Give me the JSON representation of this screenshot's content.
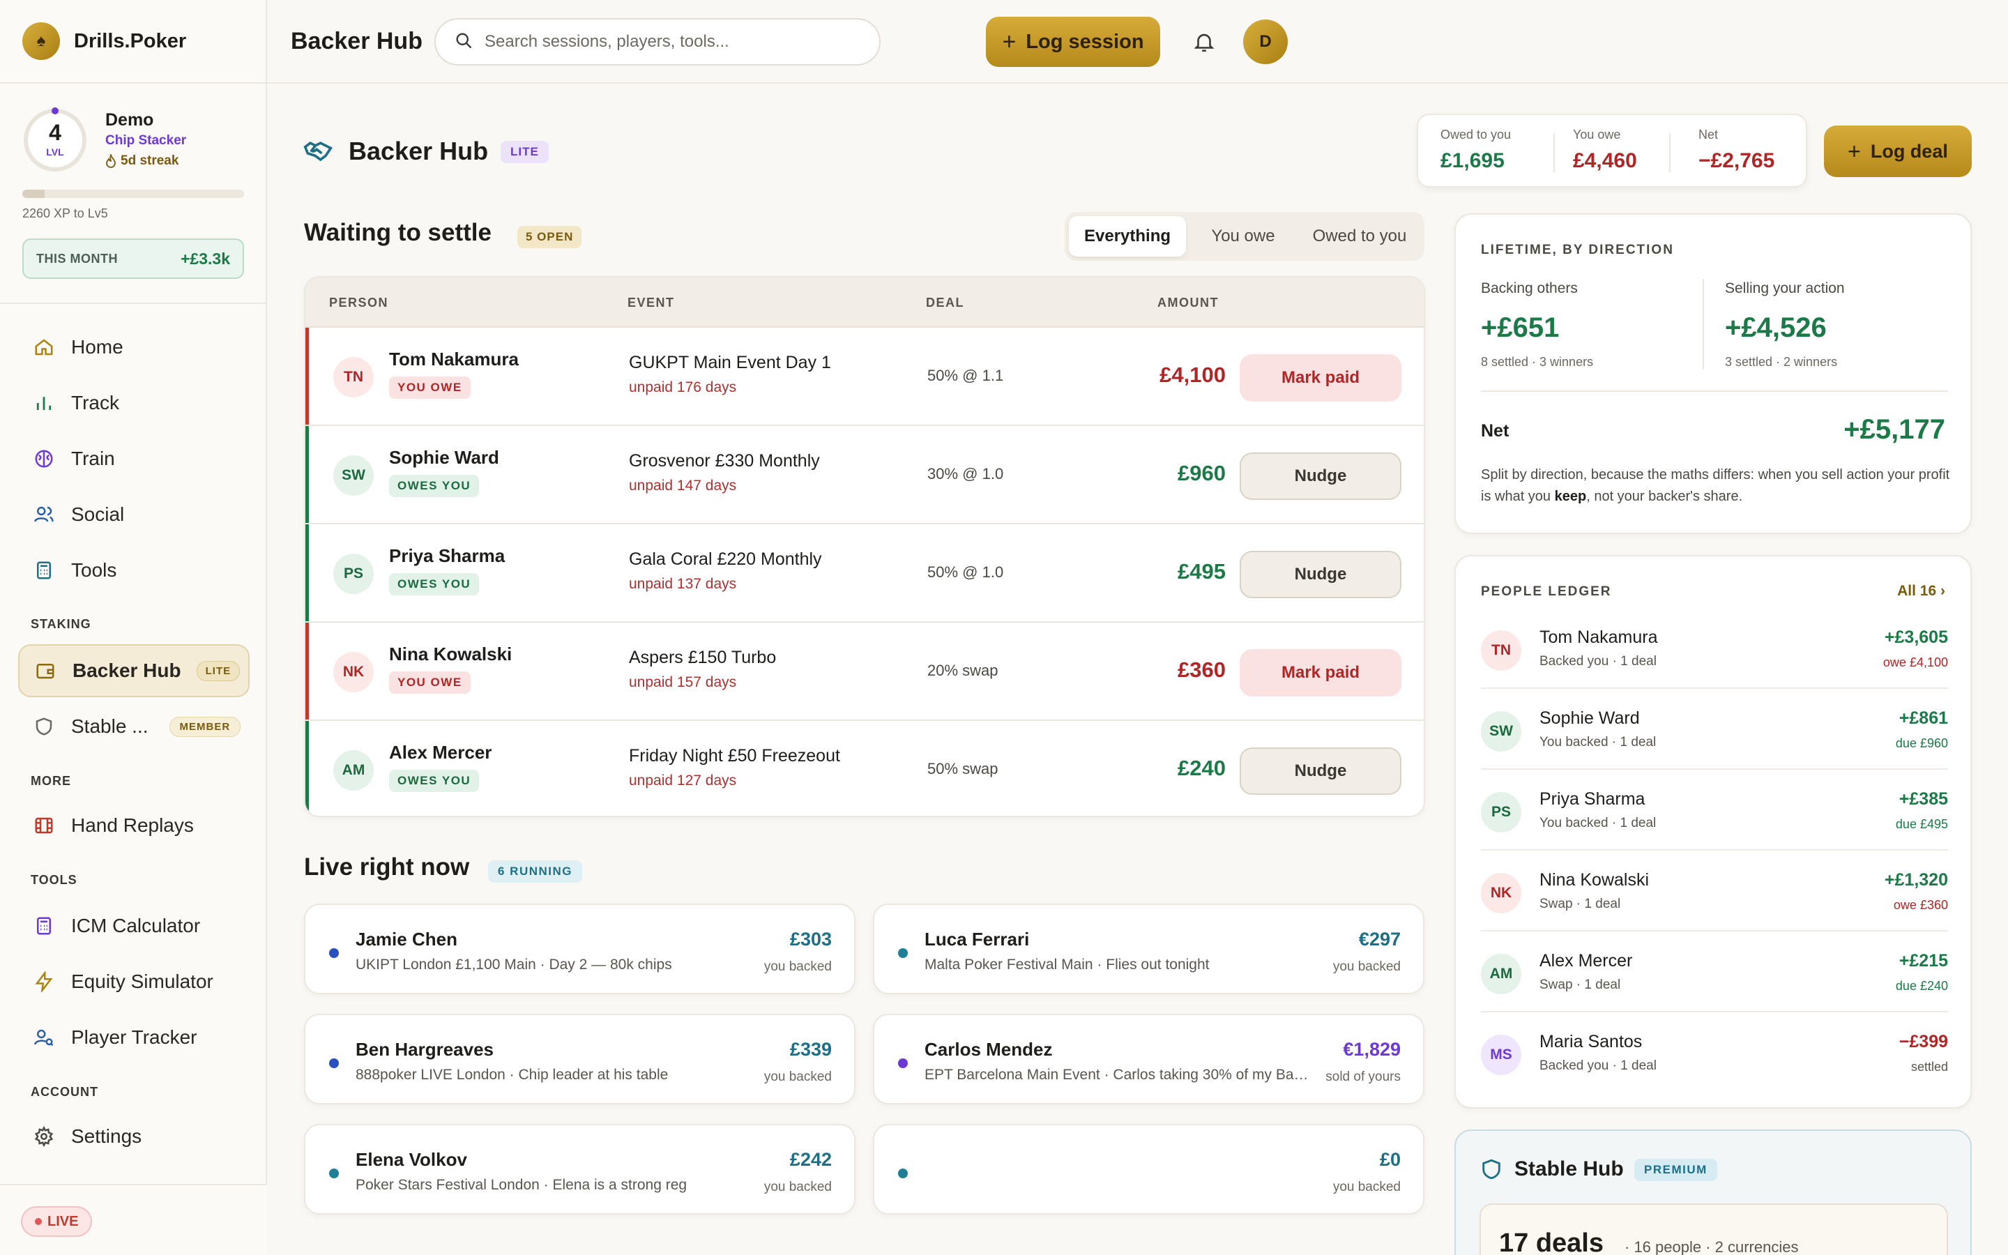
{
  "brand": {
    "name": "Drills.Poker"
  },
  "profile": {
    "level": "4",
    "level_label": "LVL",
    "name": "Demo",
    "rank": "Chip Stacker",
    "streak": "5d streak",
    "xp_text": "2260 XP to Lv5",
    "xp_progress": 0.1,
    "month_label": "THIS MONTH",
    "month_value": "+£3.3k"
  },
  "nav": {
    "home": "Home",
    "track": "Track",
    "train": "Train",
    "social": "Social",
    "tools": "Tools",
    "staking_section": "STAKING",
    "backer_hub": "Backer Hub",
    "backer_tag": "LITE",
    "stable": "Stable ...",
    "stable_tag": "MEMBER",
    "more_section": "MORE",
    "hand_replays": "Hand Replays",
    "tools_section": "TOOLS",
    "icm": "ICM Calculator",
    "equity": "Equity Simulator",
    "tracker": "Player Tracker",
    "account_section": "ACCOUNT",
    "settings": "Settings",
    "live_label": "LIVE"
  },
  "topbar": {
    "title": "Backer Hub",
    "search_placeholder": "Search sessions, players, tools...",
    "log_session": "Log session",
    "avatar": "D"
  },
  "header": {
    "title": "Backer Hub",
    "tag": "LITE",
    "owed_to_you_label": "Owed to you",
    "owed_to_you": "£1,695",
    "you_owe_label": "You owe",
    "you_owe": "£4,460",
    "net_label": "Net",
    "net": "−£2,765",
    "log_deal": "Log deal"
  },
  "settle": {
    "title": "Waiting to settle",
    "badge": "5 OPEN",
    "filters": [
      "Everything",
      "You owe",
      "Owed to you"
    ],
    "columns": [
      "PERSON",
      "EVENT",
      "DEAL",
      "AMOUNT"
    ],
    "rows": [
      {
        "initials": "TN",
        "name": "Tom Nakamura",
        "badge": "YOU OWE",
        "event": "GUKPT Main Event Day 1",
        "unpaid": "unpaid 176 days",
        "deal": "50% @ 1.1",
        "amount": "£4,100",
        "action": "Mark paid"
      },
      {
        "initials": "SW",
        "name": "Sophie Ward",
        "badge": "OWES YOU",
        "event": "Grosvenor £330 Monthly",
        "unpaid": "unpaid 147 days",
        "deal": "30% @ 1.0",
        "amount": "£960",
        "action": "Nudge"
      },
      {
        "initials": "PS",
        "name": "Priya Sharma",
        "badge": "OWES YOU",
        "event": "Gala Coral £220 Monthly",
        "unpaid": "unpaid 137 days",
        "deal": "50% @ 1.0",
        "amount": "£495",
        "action": "Nudge"
      },
      {
        "initials": "NK",
        "name": "Nina Kowalski",
        "badge": "YOU OWE",
        "event": "Aspers £150 Turbo",
        "unpaid": "unpaid 157 days",
        "deal": "20% swap",
        "amount": "£360",
        "action": "Mark paid"
      },
      {
        "initials": "AM",
        "name": "Alex Mercer",
        "badge": "OWES YOU",
        "event": "Friday Night £50 Freezeout",
        "unpaid": "unpaid 127 days",
        "deal": "50% swap",
        "amount": "£240",
        "action": "Nudge"
      }
    ]
  },
  "live": {
    "title": "Live right now",
    "badge": "6 RUNNING",
    "cards": [
      {
        "name": "Jamie Chen",
        "sub": "UKIPT London £1,100 Main · Day 2 — 80k chips",
        "amount": "£303",
        "label": "you backed"
      },
      {
        "name": "Luca Ferrari",
        "sub": "Malta Poker Festival Main · Flies out tonight",
        "amount": "€297",
        "label": "you backed"
      },
      {
        "name": "Ben Hargreaves",
        "sub": "888poker LIVE London · Chip leader at his table",
        "amount": "£339",
        "label": "you backed"
      },
      {
        "name": "Carlos Mendez",
        "sub": "EPT Barcelona Main Event · Carlos taking 30% of my Barce...",
        "amount": "€1,829",
        "label": "sold of yours"
      },
      {
        "name": "Elena Volkov",
        "sub": "Poker Stars Festival London · Elena is a strong reg",
        "amount": "£242",
        "label": "you backed"
      },
      {
        "name": "",
        "sub": "",
        "amount": "£0",
        "label": "you backed"
      }
    ]
  },
  "lifetime": {
    "title": "LIFETIME, BY DIRECTION",
    "backing_label": "Backing others",
    "backing_value": "+£651",
    "backing_sub": "8 settled · 3 winners",
    "selling_label": "Selling your action",
    "selling_value": "+£4,526",
    "selling_sub": "3 settled · 2 winners",
    "net_label": "Net",
    "net_value": "+£5,177",
    "note_pre": "Split by direction, because the maths differs: when you sell action your profit is what you ",
    "note_bold": "keep",
    "note_post": ", not your backer's share."
  },
  "ledger": {
    "title": "PEOPLE LEDGER",
    "all_link": "All 16 ›",
    "rows": [
      {
        "initials": "TN",
        "name": "Tom Nakamura",
        "detail": "Backed you · 1 deal",
        "value": "+£3,605",
        "sub": "owe £4,100"
      },
      {
        "initials": "SW",
        "name": "Sophie Ward",
        "detail": "You backed · 1 deal",
        "value": "+£861",
        "sub": "due £960"
      },
      {
        "initials": "PS",
        "name": "Priya Sharma",
        "detail": "You backed · 1 deal",
        "value": "+£385",
        "sub": "due £495"
      },
      {
        "initials": "NK",
        "name": "Nina Kowalski",
        "detail": "Swap · 1 deal",
        "value": "+£1,320",
        "sub": "owe £360"
      },
      {
        "initials": "AM",
        "name": "Alex Mercer",
        "detail": "Swap · 1 deal",
        "value": "+£215",
        "sub": "due £240"
      },
      {
        "initials": "MS",
        "name": "Maria Santos",
        "detail": "Backed you · 1 deal",
        "value": "−£399",
        "sub": "settled"
      }
    ]
  },
  "stable": {
    "title": "Stable Hub",
    "tag": "PREMIUM",
    "deals": "17 deals",
    "summary": "· 16 people · 2 currencies"
  },
  "colors": {
    "gold": "#c29a2a",
    "green": "#1b7a47",
    "red": "#b02525",
    "purple": "#6c39d4",
    "teal": "#1e6f86"
  }
}
